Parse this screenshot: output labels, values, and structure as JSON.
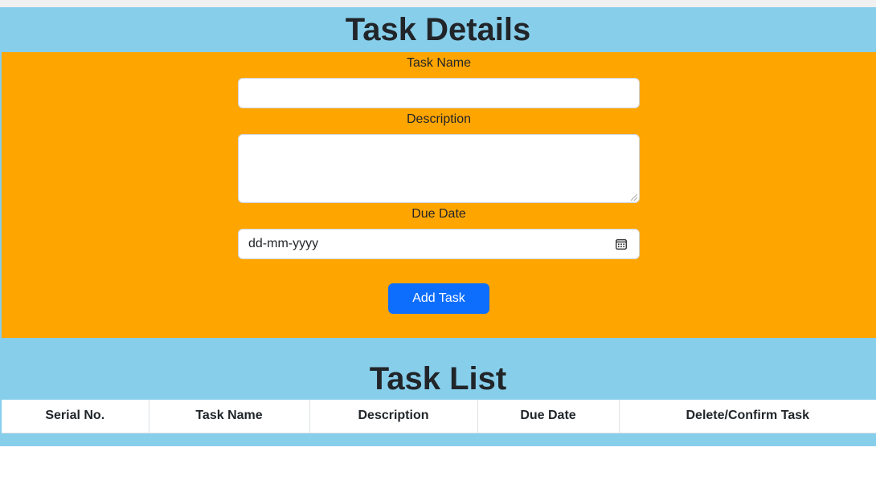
{
  "details": {
    "title": "Task Details",
    "task_name_label": "Task Name",
    "task_name_value": "",
    "description_label": "Description",
    "description_value": "",
    "due_date_label": "Due Date",
    "due_date_placeholder": "dd-mm-yyyy",
    "add_button_label": "Add Task"
  },
  "list": {
    "title": "Task List",
    "columns": [
      "Serial No.",
      "Task Name",
      "Description",
      "Due Date",
      "Delete/Confirm Task"
    ]
  },
  "colors": {
    "header_bg": "#87ceeb",
    "form_bg": "#ffa500",
    "button_bg": "#0d6efd"
  },
  "icons": {
    "date_picker": "calendar-icon"
  }
}
